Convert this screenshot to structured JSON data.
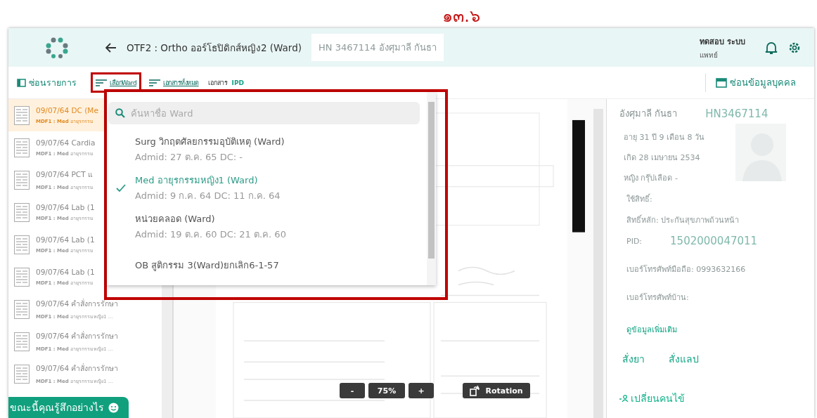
{
  "annotation": {
    "title": "๑๓.๖"
  },
  "header": {
    "title": "OTF2 : Ortho ออร์โธปิดิกส์หญิง2 (Ward)",
    "patient_badge": "HN 3467114 อังศุมาลี กันธา",
    "user_name": "ทดสอบ ระบบ",
    "user_role": "แพทย์"
  },
  "toolbar": {
    "hide_list": "ซ่อนรายการ",
    "items": [
      {
        "label": "เลือกWard",
        "kind": "filter",
        "highlighted": true
      },
      {
        "label": "เอกสารทั้งหมด",
        "kind": "filter",
        "highlighted": false
      },
      {
        "label": "เอกสาร",
        "kind": "text"
      },
      {
        "label": "IPD",
        "kind": "accent"
      }
    ],
    "hide_profile": "ซ่อนข้อมูลบุคคล"
  },
  "documents": [
    {
      "title": "09/07/64 DC (Me",
      "subtitle": "**MDF1 : Med** อายุรกรรม",
      "selected": true
    },
    {
      "title": "09/07/64 Cardia",
      "subtitle": "**MDF1 : Med** อายุรกรรม",
      "selected": false
    },
    {
      "title": "09/07/64 PCT แ",
      "subtitle": "**MDF1 : Med** อายุรกรรม",
      "selected": false
    },
    {
      "title": "09/07/64 Lab (1",
      "subtitle": "**MDF1 : Med** อายุรกรรม",
      "selected": false
    },
    {
      "title": "09/07/64 Lab (1",
      "subtitle": "**MDF1 : Med** อายุรกรรม",
      "selected": false
    },
    {
      "title": "09/07/64 Lab (1",
      "subtitle": "**MDF1 : Med** อายุรกรรม",
      "selected": false
    },
    {
      "title": "09/07/64 คำสั่งการรักษา",
      "subtitle": "**MDF1 : Med** อายุรกรรมหญิง1 ...",
      "selected": false
    },
    {
      "title": "09/07/64 คำสั่งการรักษา",
      "subtitle": "**MDF1 : Med** อายุรกรรมหญิง1 ...",
      "selected": false
    },
    {
      "title": "09/07/64 คำสั่งการรักษา",
      "subtitle": "**MDF1 : Med** อายุรกรรมหญิง1 ...",
      "selected": false
    }
  ],
  "feedback": "ขณะนี้คุณรู้สึกอย่างไร",
  "ward_dropdown": {
    "highlighted": true,
    "placeholder": "ค้นหาชื่อ Ward",
    "wards": [
      {
        "name": "Surg วิกฤตศัลยกรรมอุบัติเหตุ (Ward)",
        "admit": "Admid: 27 ต.ค. 65 DC: -",
        "selected": false
      },
      {
        "name": "Med อายุรกรรมหญิง1 (Ward)",
        "admit": "Admid: 9 ก.ค. 64 DC: 11 ก.ค. 64",
        "selected": true
      },
      {
        "name": "หน่วยคลอด (Ward)",
        "admit": "Admid: 19 ต.ค. 60 DC: 21 ต.ค. 60",
        "selected": false
      },
      {
        "name": "OB สูติกรรม 3(Ward)ยกเลิก6-1-57",
        "selected": false
      }
    ]
  },
  "viewer": {
    "zoom_out": "-",
    "zoom": "75%",
    "zoom_in": "+",
    "rotate": "Rotation"
  },
  "profile": {
    "name": "อังศุมาลี กันธา",
    "hn": "HN3467114",
    "details": [
      "อายุ 31 ปี 9 เดือน 8 วัน",
      "เกิด 28 เมษายน 2534",
      "หญิง กรุ๊ปเลือด -"
    ],
    "rights": [
      "ใช้สิทธิ์:",
      "สิทธิ์หลัก: ประกันสุขภาพถ้วนหน้า"
    ],
    "pid_label": "PID:",
    "pid": "1502000047011",
    "phones": [
      "เบอร์โทรศัพท์มือถือ: 0993632166",
      "เบอร์โทรศัพท์บ้าน:"
    ],
    "more": "ดูข้อมูลเพิ่มเติม",
    "actions": [
      "สั่งยา",
      "สั่งแลป"
    ],
    "change": "เปลี่ยนคนไข้"
  }
}
